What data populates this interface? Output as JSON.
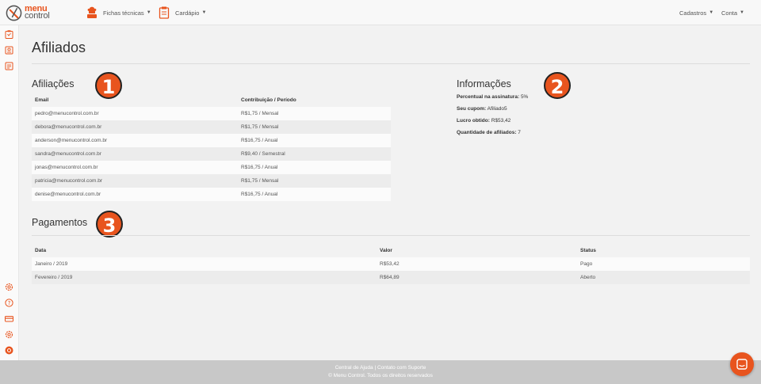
{
  "navbar": {
    "menu_items": [
      {
        "label": "Fichas técnicas",
        "icon": "chef-hat-icon"
      },
      {
        "label": "Cardápio",
        "icon": "menu-card-icon"
      }
    ],
    "right_items": [
      {
        "label": "Cadastros"
      },
      {
        "label": "Conta"
      }
    ]
  },
  "sidebar": {
    "top_icons": [
      "recipe-sheet-icon",
      "menu-book-icon",
      "report-icon"
    ],
    "bottom_icons": [
      "settings-icon",
      "help-icon",
      "payment-card-icon",
      "gear-icon",
      "power-icon"
    ]
  },
  "page": {
    "title": "Afiliados"
  },
  "affiliations": {
    "title": "Afiliações",
    "badge": "1",
    "columns": [
      "Email",
      "Contribuição / Período"
    ],
    "rows": [
      [
        "pedro@menucontrol.com.br",
        "R$1,75 / Mensal"
      ],
      [
        "debora@menucontrol.com.br",
        "R$1,75 / Mensal"
      ],
      [
        "anderson@menucontrol.com.br",
        "R$16,75 / Anual"
      ],
      [
        "sandra@menucontrol.com.br",
        "R$9,40 / Semestral"
      ],
      [
        "jonas@menucontrol.com.br",
        "R$16,75 / Anual"
      ],
      [
        "patricia@menucontrol.com.br",
        "R$1,75 / Mensal"
      ],
      [
        "denise@menucontrol.com.br",
        "R$16,75 / Anual"
      ]
    ]
  },
  "info": {
    "title": "Informações",
    "badge": "2",
    "items": [
      {
        "label": "Percentual na assinatura:",
        "value": "5%"
      },
      {
        "label": "Seu cupom:",
        "value": "Afiliado5"
      },
      {
        "label": "Lucro obtido:",
        "value": "R$53,42"
      },
      {
        "label": "Quantidade de afiliados:",
        "value": "7"
      }
    ]
  },
  "payments": {
    "title": "Pagamentos",
    "badge": "3",
    "columns": [
      "Data",
      "Valor",
      "Status"
    ],
    "rows": [
      [
        "Janeiro / 2019",
        "R$53,42",
        "Pago"
      ],
      [
        "Fevereiro / 2019",
        "R$64,89",
        "Aberto"
      ]
    ]
  },
  "footer": {
    "links": "Central de Ajuda | Contato com Suporte",
    "copyright": "© Menu Control. Todos os direitos reservados"
  },
  "colors": {
    "accent": "#e8541e",
    "footer_bg": "#c8c8c8"
  }
}
